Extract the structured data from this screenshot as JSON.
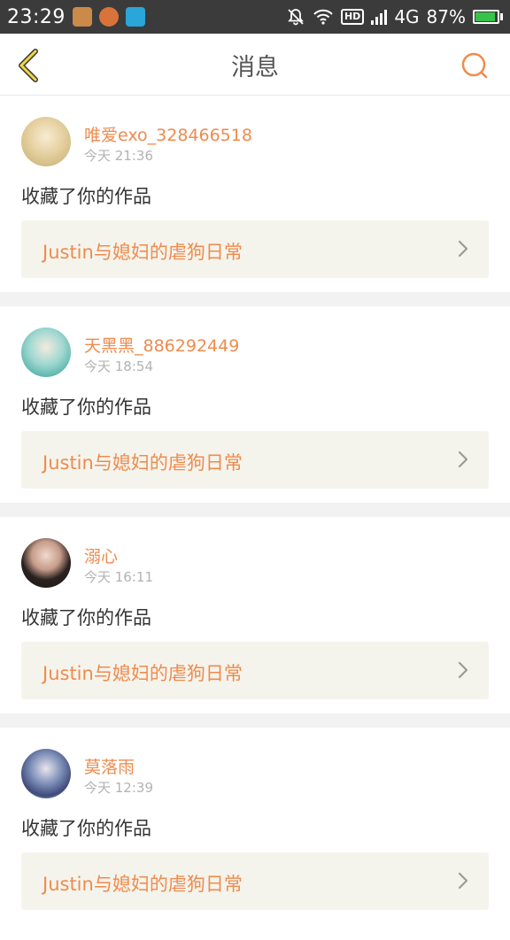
{
  "status_bar": {
    "time": "23:29",
    "network": "4G",
    "hd": "HD",
    "battery": "87%"
  },
  "nav": {
    "title": "消息",
    "icons": {
      "back": "chevron-left-icon",
      "search": "search-icon"
    },
    "accent_color": "#ef8b4e"
  },
  "messages": [
    {
      "user": "唯爱exo_328466518",
      "time": "今天 21:36",
      "action": "收藏了你的作品",
      "work": "Justin与媳妇的虐狗日常"
    },
    {
      "user": "天黑黑_886292449",
      "time": "今天 18:54",
      "action": "收藏了你的作品",
      "work": "Justin与媳妇的虐狗日常"
    },
    {
      "user": "溺心",
      "time": "今天 16:11",
      "action": "收藏了你的作品",
      "work": "Justin与媳妇的虐狗日常"
    },
    {
      "user": "莫落雨",
      "time": "今天 12:39",
      "action": "收藏了你的作品",
      "work": "Justin与媳妇的虐狗日常"
    }
  ]
}
